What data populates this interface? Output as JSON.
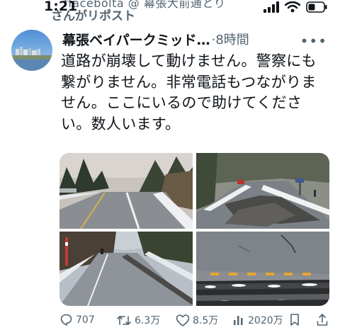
{
  "status_bar": {
    "time": "1:21",
    "overlap_text": "ffacebolta @ 幕張大前通とり"
  },
  "repost_line": {
    "label": "さんがリポスト"
  },
  "tweet": {
    "author": {
      "display_name": "幕張ベイパークミッド…",
      "separator_time": "·8時間"
    },
    "text": "道路が崩壊して動けません。警察にも繋がりません。非常電話もつながりません。ここにいるので助けてください。数人います。",
    "media": [
      {
        "description": "snowy road in forest"
      },
      {
        "description": "cracked road with car"
      },
      {
        "description": "road curving through forest"
      },
      {
        "description": "close up of broken asphalt"
      }
    ],
    "actions": {
      "replies": "707",
      "reposts": "6.3万",
      "likes": "8.5万",
      "views": "2020万"
    }
  },
  "colors": {
    "text": "#0f1419",
    "secondary": "#536471"
  }
}
